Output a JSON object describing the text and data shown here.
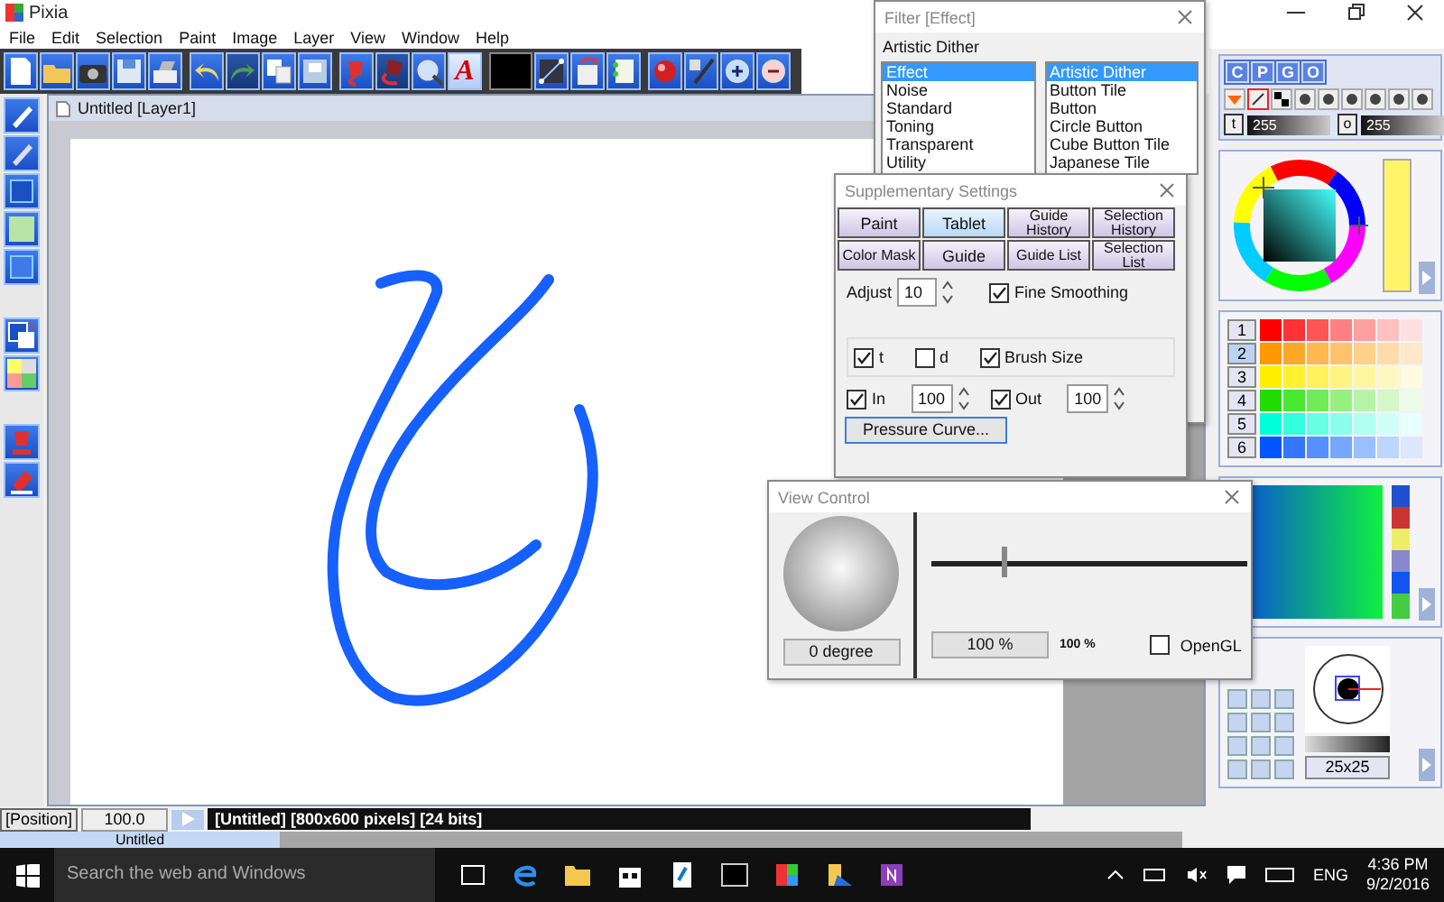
{
  "app": {
    "title": "Pixia"
  },
  "menu": [
    "File",
    "Edit",
    "Selection",
    "Paint",
    "Image",
    "Layer",
    "View",
    "Window",
    "Help"
  ],
  "toolbar": {
    "text_tool": "A"
  },
  "document": {
    "title": "Untitled [Layer1]"
  },
  "filter_window": {
    "title": "Filter [Effect]",
    "current": "Artistic Dither",
    "categories": [
      {
        "label": "Effect",
        "selected": true
      },
      {
        "label": "Noise",
        "selected": false
      },
      {
        "label": "Standard",
        "selected": false
      },
      {
        "label": "Toning",
        "selected": false
      },
      {
        "label": "Transparent",
        "selected": false
      },
      {
        "label": "Utility",
        "selected": false
      }
    ],
    "effects": [
      {
        "label": "Artistic Dither",
        "selected": true
      },
      {
        "label": "Button Tile",
        "selected": false
      },
      {
        "label": "Button",
        "selected": false
      },
      {
        "label": "Circle Button",
        "selected": false
      },
      {
        "label": "Cube Button Tile",
        "selected": false
      },
      {
        "label": "Japanese Tile",
        "selected": false
      }
    ]
  },
  "supplementary_window": {
    "title": "Supplementary Settings",
    "tabs": [
      {
        "label": "Paint",
        "selected": false
      },
      {
        "label": "Tablet",
        "selected": true
      },
      {
        "label": "Guide History",
        "selected": false
      },
      {
        "label": "Selection History",
        "selected": false
      },
      {
        "label": "Color Mask",
        "selected": false
      },
      {
        "label": "Guide",
        "selected": false
      },
      {
        "label": "Guide List",
        "selected": false
      },
      {
        "label": "Selection List",
        "selected": false
      }
    ],
    "adjust": {
      "label": "Adjust",
      "value": "10"
    },
    "fine_smoothing": {
      "label": "Fine Smoothing",
      "checked": true
    },
    "pressure_options": [
      {
        "label": "t",
        "checked": true
      },
      {
        "label": "d",
        "checked": false
      },
      {
        "label": "Brush Size",
        "checked": true
      }
    ],
    "in": {
      "label": "In",
      "checked": true,
      "value": "100"
    },
    "out": {
      "label": "Out",
      "checked": true,
      "value": "100"
    },
    "button": "Pressure Curve..."
  },
  "view_window": {
    "title": "View Control",
    "rotation": "0 degree",
    "zoom": {
      "level": 0.23
    },
    "zoom_field": "100 %",
    "zoom_reading": "100 %",
    "opengl": {
      "label": "OpenGL",
      "checked": false
    }
  },
  "color_panel": {
    "tabs": [
      "C",
      "P",
      "G",
      "O"
    ],
    "sliders": [
      {
        "label": "t",
        "value": "255",
        "level": 1
      },
      {
        "label": "o",
        "value": "255",
        "level": 1
      }
    ]
  },
  "palette": {
    "rows": [
      {
        "label": "1",
        "selected": false
      },
      {
        "label": "2",
        "selected": true
      },
      {
        "label": "3",
        "selected": false
      },
      {
        "label": "4",
        "selected": false
      },
      {
        "label": "5",
        "selected": false
      },
      {
        "label": "6",
        "selected": false
      }
    ]
  },
  "brush": {
    "size": "25x25"
  },
  "status_bar": {
    "position": "[Position]",
    "zoom": "100.0",
    "info": "[Untitled] [800x600 pixels] [24 bits]"
  },
  "document_tabs": [
    {
      "label": "Untitled",
      "selected": true
    }
  ],
  "taskbar": {
    "search_placeholder": "Search the web and Windows",
    "language": "ENG",
    "time": "4:36 PM",
    "date": "9/2/2016"
  }
}
